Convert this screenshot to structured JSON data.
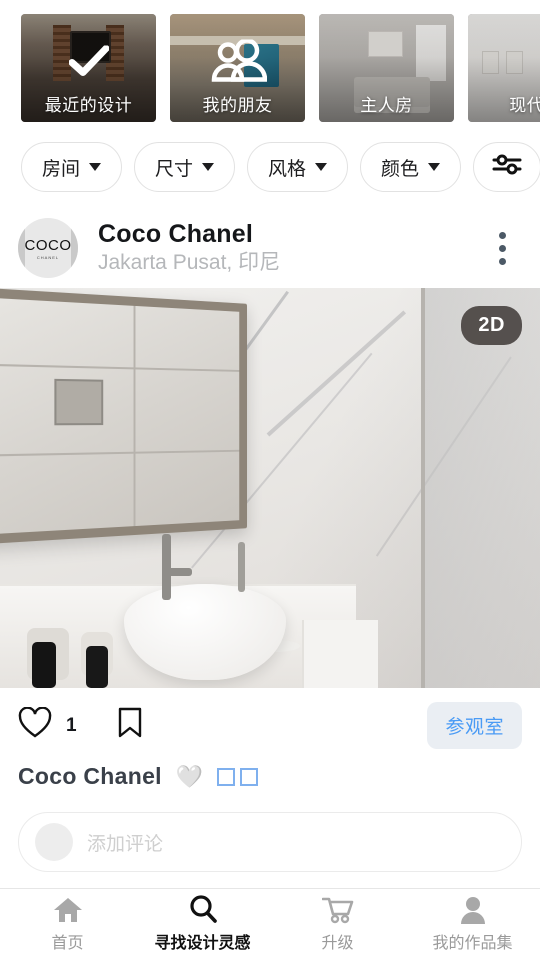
{
  "categories": [
    {
      "label": "最近的设计",
      "icon": "check-icon",
      "photo": "living-room"
    },
    {
      "label": "我的朋友",
      "icon": "people-icon",
      "photo": "attic-room"
    },
    {
      "label": "主人房",
      "icon": "",
      "photo": "bedroom"
    },
    {
      "label": "现代厨",
      "icon": "",
      "photo": "kitchen"
    }
  ],
  "filters": [
    {
      "label": "房间",
      "icon": "chevron-down-icon"
    },
    {
      "label": "尺寸",
      "icon": "chevron-down-icon"
    },
    {
      "label": "风格",
      "icon": "chevron-down-icon"
    },
    {
      "label": "颜色",
      "icon": "chevron-down-icon"
    },
    {
      "label": "",
      "icon": "tune-sliders-icon"
    }
  ],
  "post": {
    "author": "Coco Chanel",
    "location": "Jakarta Pusat, 印尼",
    "avatar_brand": "COCO",
    "avatar_sub": "CHANEL",
    "menu_icon": "kebab-menu-icon",
    "image_badge": "2D",
    "image_alt": "marble-bathroom-render",
    "like_icon": "heart-outline-icon",
    "like_count": "1",
    "bookmark_icon": "bookmark-outline-icon",
    "visit_label": "参观室",
    "caption_title": "Coco Chanel",
    "caption_heart": "🤍",
    "caption_tofu_count": 2
  },
  "composer": {
    "placeholder": "添加评论",
    "avatar_icon": "user-avatar-icon"
  },
  "bottom_nav": [
    {
      "label": "首页",
      "icon": "home-icon",
      "active": false
    },
    {
      "label": "寻找设计灵感",
      "icon": "search-icon",
      "active": true
    },
    {
      "label": "升级",
      "icon": "cart-icon",
      "active": false
    },
    {
      "label": "我的作品集",
      "icon": "person-icon",
      "active": false
    }
  ],
  "colors": {
    "accent_blue": "#4a9bf5",
    "visit_bg": "#eaeef3",
    "tofu_border": "#7fb0ee",
    "muted_text": "#b5b7ba",
    "nav_inactive": "#9a9a9a"
  }
}
